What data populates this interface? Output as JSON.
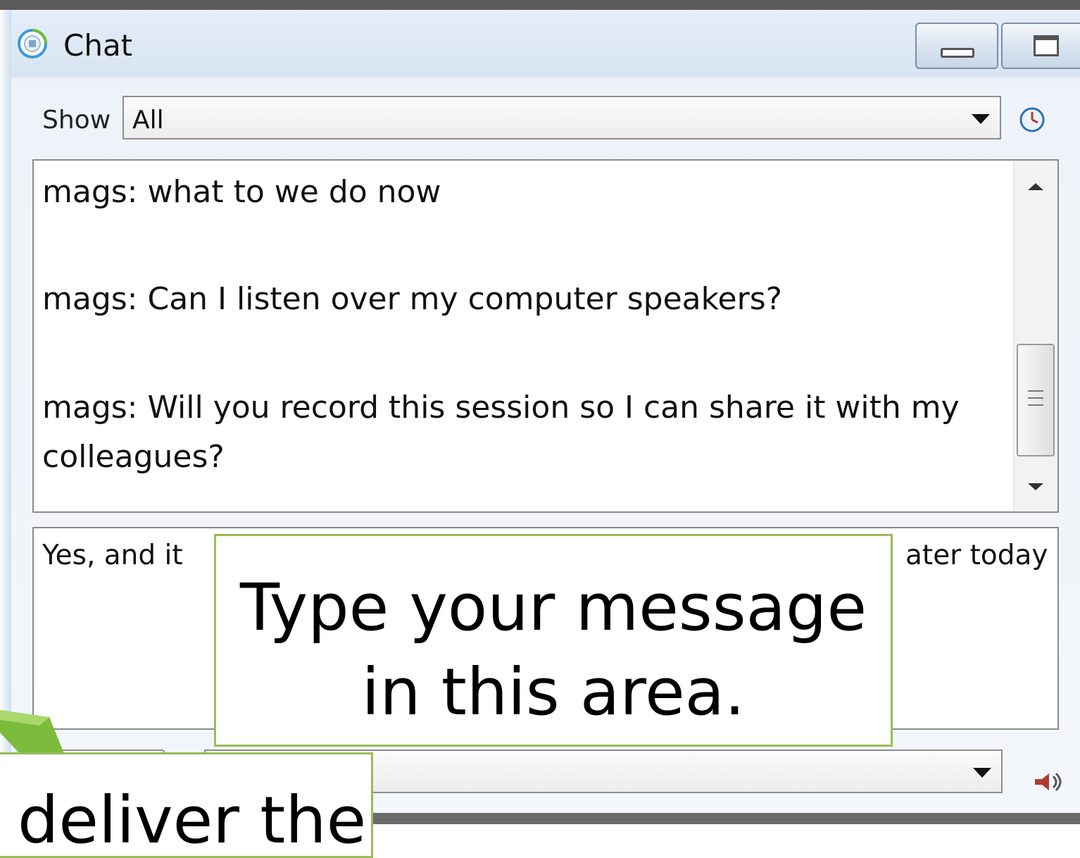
{
  "window": {
    "title": "Chat"
  },
  "filter": {
    "label": "Show",
    "selected": "All"
  },
  "transcript": {
    "messages": [
      {
        "text": "mags: what to we do now"
      },
      {
        "text": "mags: Can I listen over my computer speakers?"
      },
      {
        "text": "mags: Will you record this session so I can share it with my colleagues?"
      }
    ]
  },
  "compose": {
    "visible_start": "Yes, and it",
    "visible_end": "ater today"
  },
  "callouts": {
    "message_area_line1": "Type your message",
    "message_area_line2": "in this area.",
    "send_hint": "deliver the"
  },
  "icons": {
    "app": "chat-app-icon",
    "clock": "clock-icon",
    "speaker": "speaker-icon",
    "minimize": "minimize-icon",
    "maximize": "maximize-icon",
    "callout_arrow": "green-arrow-icon"
  },
  "colors": {
    "callout_border": "#9bbb59",
    "titlebar": "#dfe9f5"
  }
}
